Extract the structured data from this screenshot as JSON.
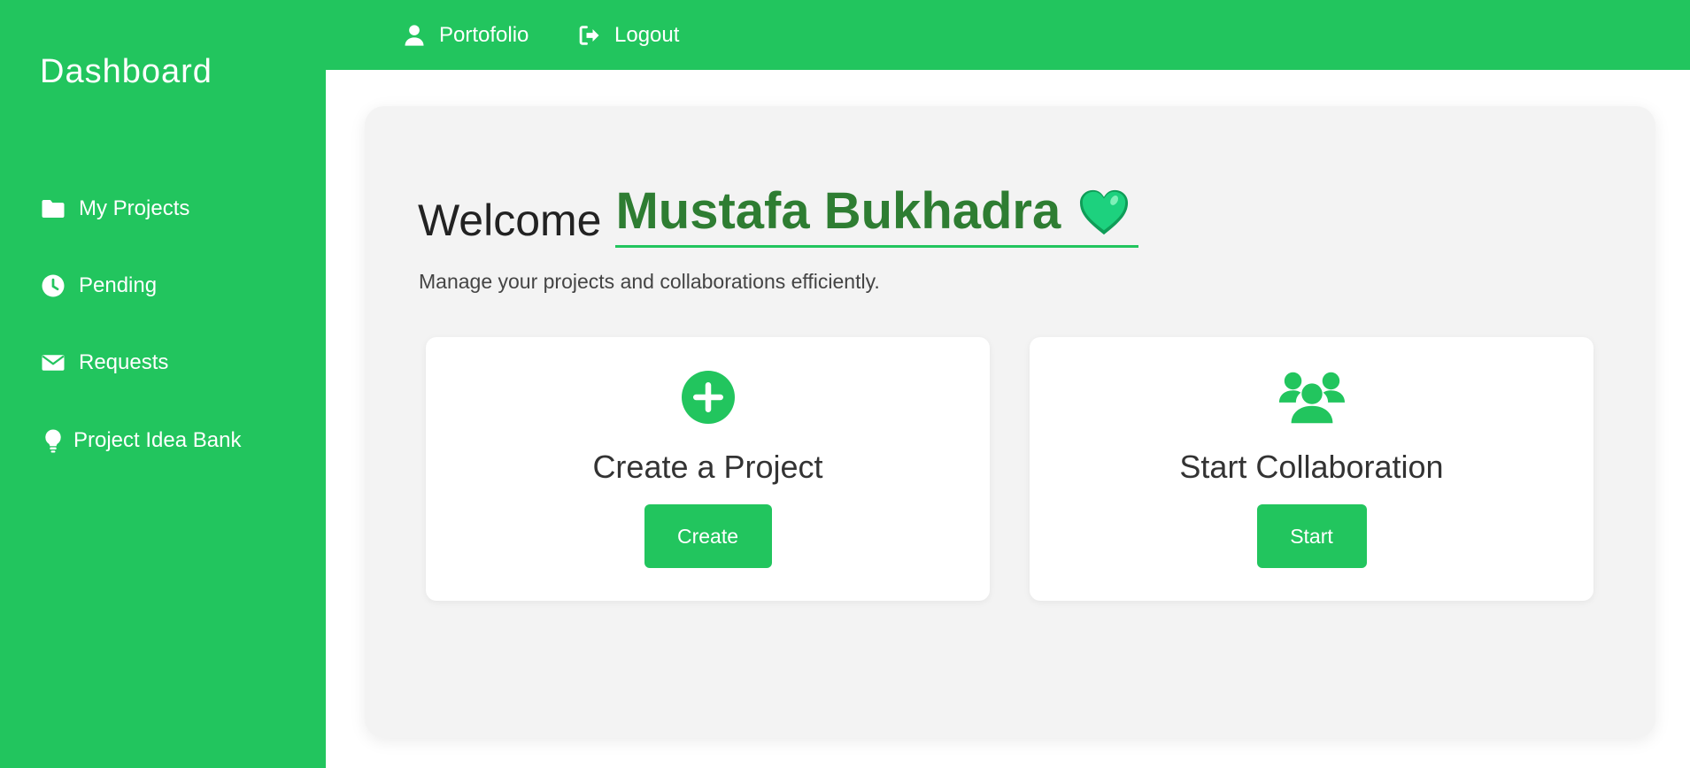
{
  "sidebar": {
    "title": "Dashboard",
    "items": [
      {
        "label": "My Projects",
        "icon": "folder-icon"
      },
      {
        "label": "Pending",
        "icon": "clock-icon"
      },
      {
        "label": "Requests",
        "icon": "envelope-icon"
      },
      {
        "label": "Project Idea Bank",
        "icon": "lightbulb-icon"
      }
    ]
  },
  "topbar": {
    "links": [
      {
        "label": "Portofolio",
        "icon": "user-icon"
      },
      {
        "label": "Logout",
        "icon": "sign-out-icon"
      }
    ]
  },
  "main": {
    "welcome_word": "Welcome",
    "user_name": "Mustafa Bukhadra",
    "name_emoji": "green-heart-icon",
    "subtitle": "Manage your projects and collaborations efficiently.",
    "cards": [
      {
        "title": "Create a Project",
        "button": "Create",
        "icon": "plus-circle-icon"
      },
      {
        "title": "Start Collaboration",
        "button": "Start",
        "icon": "users-icon"
      }
    ]
  },
  "colors": {
    "accent": "#22c55e",
    "name_text": "#2e7d32",
    "panel_bg": "#f3f3f3",
    "heart": "#16c67a"
  }
}
